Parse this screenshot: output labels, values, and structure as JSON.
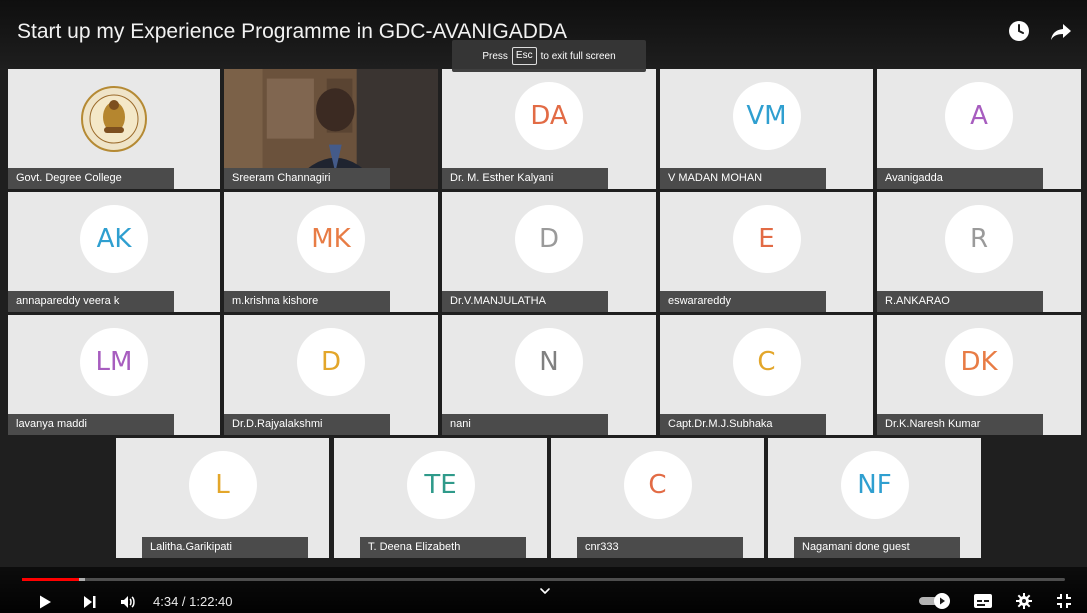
{
  "window": {
    "title": "Start up my Experience Programme in GDC-AVANIGADDA"
  },
  "esc_hint": {
    "prefix": "Press",
    "key": "Esc",
    "suffix": "to exit full screen"
  },
  "participants_grid": [
    {
      "name": "Govt. Degree College",
      "initials": "",
      "kind": "logo",
      "color": ""
    },
    {
      "name": "Sreeram Channagiri",
      "initials": "",
      "kind": "video",
      "color": ""
    },
    {
      "name": "Dr. M. Esther Kalyani",
      "initials": "DA",
      "kind": "avatar",
      "color": "#e26b45"
    },
    {
      "name": "V MADAN MOHAN",
      "initials": "VM",
      "kind": "avatar",
      "color": "#2f9fd0"
    },
    {
      "name": "Avanigadda",
      "initials": "A",
      "kind": "avatar",
      "color": "#a75dbf"
    },
    {
      "name": "annapareddy veera k",
      "initials": "AK",
      "kind": "avatar",
      "color": "#2f9fd0"
    },
    {
      "name": "m.krishna kishore",
      "initials": "MK",
      "kind": "avatar",
      "color": "#e87c45"
    },
    {
      "name": "Dr.V.MANJULATHA",
      "initials": "D",
      "kind": "avatar",
      "color": "#9a9a9a"
    },
    {
      "name": "eswarareddy",
      "initials": "E",
      "kind": "avatar",
      "color": "#e26b45"
    },
    {
      "name": "R.ANKARAO",
      "initials": "R",
      "kind": "avatar",
      "color": "#9a9a9a"
    },
    {
      "name": "lavanya maddi",
      "initials": "LM",
      "kind": "avatar",
      "color": "#a75dbf"
    },
    {
      "name": "Dr.D.Rajyalakshmi",
      "initials": "D",
      "kind": "avatar",
      "color": "#e3a62a"
    },
    {
      "name": "nani",
      "initials": "N",
      "kind": "avatar",
      "color": "#808080"
    },
    {
      "name": "Capt.Dr.M.J.Subhaka",
      "initials": "C",
      "kind": "avatar",
      "color": "#e3a62a"
    },
    {
      "name": "Dr.K.Naresh Kumar",
      "initials": "DK",
      "kind": "avatar",
      "color": "#e87c45"
    }
  ],
  "participants_bottom": [
    {
      "name": "Lalitha.Garikipati",
      "initials": "L",
      "kind": "avatar",
      "color": "#e3a62a"
    },
    {
      "name": "T. Deena Elizabeth",
      "initials": "TE",
      "kind": "avatar",
      "color": "#2f9a8a"
    },
    {
      "name": "cnr333",
      "initials": "C",
      "kind": "avatar",
      "color": "#e26b45"
    },
    {
      "name": "Nagamani done guest",
      "initials": "NF",
      "kind": "avatar",
      "color": "#2f9fd0"
    }
  ],
  "player": {
    "time_label": "4:34 / 1:22:40",
    "progress_fraction": 0.055,
    "buffered_fraction": 0.06
  },
  "icons": {
    "top": [
      "clock-icon",
      "share-icon"
    ],
    "controls": [
      "play-icon",
      "next-icon",
      "volume-icon",
      "chevron-down-icon",
      "autoplay-toggle-icon",
      "subtitles-icon",
      "settings-icon",
      "exit-fullscreen-icon"
    ]
  }
}
